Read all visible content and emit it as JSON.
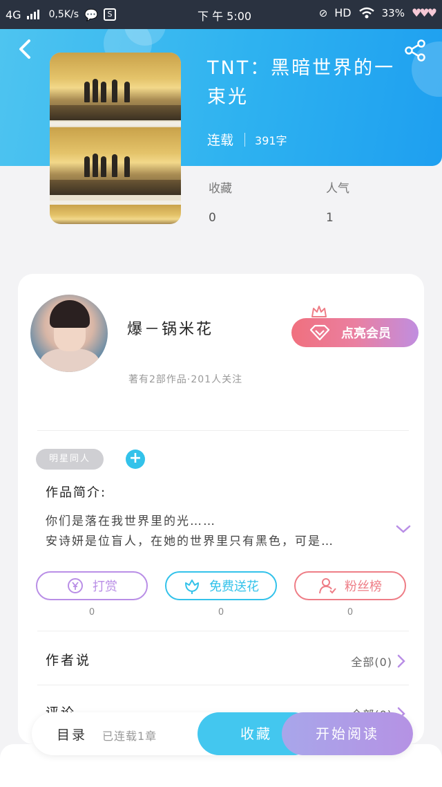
{
  "status_bar": {
    "network": "4G",
    "speed": "0,5K/s",
    "time": "下 午 5:00",
    "hd": "HD",
    "battery": "33%"
  },
  "book": {
    "title": "TNT：黑暗世界的一束光",
    "status": "连载",
    "word_count": "391字",
    "favorites_label": "收藏",
    "favorites_value": "0",
    "popularity_label": "人气",
    "popularity_value": "1"
  },
  "author": {
    "name": "爆－锅米花",
    "meta": "著有2部作品·201人关注",
    "vip_button": "点亮会员"
  },
  "tags": {
    "items": [
      "明星同人"
    ],
    "add": "+"
  },
  "intro": {
    "title": "作品简介:",
    "line1": "你们是落在我世界里的光……",
    "line2": "安诗妍是位盲人，在她的世界里只有黑色，可是…"
  },
  "actions": [
    {
      "label": "打赏",
      "count": "0",
      "color": "#b98ee6"
    },
    {
      "label": "免费送花",
      "count": "0",
      "color": "#33c2ea"
    },
    {
      "label": "粉丝榜",
      "count": "0",
      "color": "#ee7d86"
    }
  ],
  "author_says": {
    "title": "作者说",
    "more": "全部(0)"
  },
  "comments": {
    "title": "评论",
    "more": "全部(0)"
  },
  "bottom_bar": {
    "toc": "目录",
    "chapters": "已连载1章",
    "favorite": "收藏",
    "read": "开始阅读"
  },
  "colors": {
    "header_start": "#4ec4f0",
    "header_end": "#1e9ff0",
    "accent_blue": "#43c7ef",
    "accent_purple": "#b592e4",
    "vip_pink": "#f0707e"
  }
}
